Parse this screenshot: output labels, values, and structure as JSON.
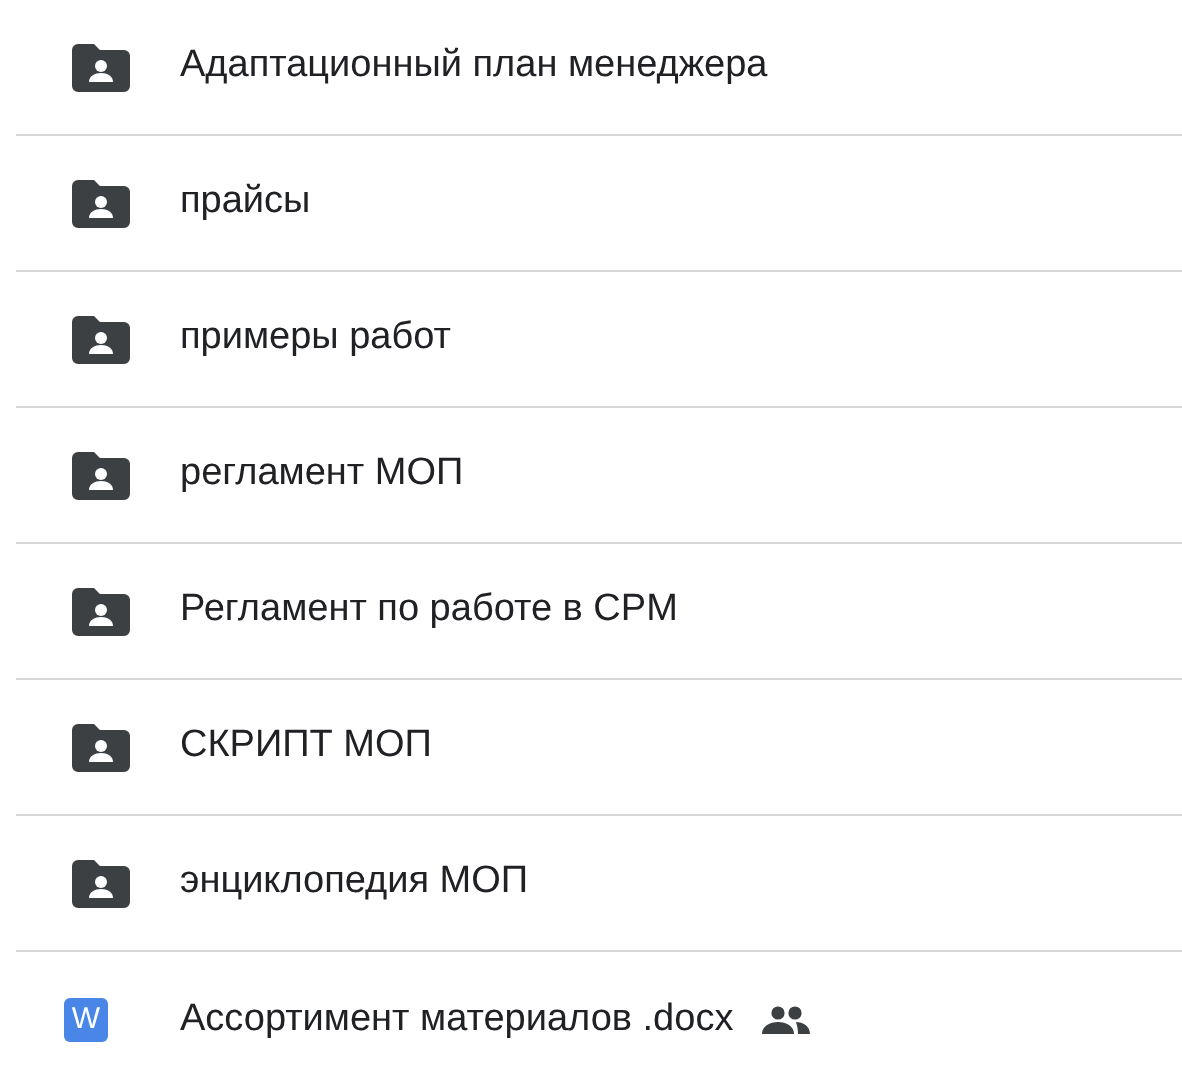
{
  "items": [
    {
      "kind": "folder",
      "name": "Адаптационный план менеджера",
      "shared": false
    },
    {
      "kind": "folder",
      "name": "прайсы",
      "shared": false
    },
    {
      "kind": "folder",
      "name": "примеры работ",
      "shared": false
    },
    {
      "kind": "folder",
      "name": "регламент МОП",
      "shared": false
    },
    {
      "kind": "folder",
      "name": "Регламент по работе в CPM",
      "shared": false
    },
    {
      "kind": "folder",
      "name": "СКРИПТ МОП",
      "shared": false
    },
    {
      "kind": "folder",
      "name": "энциклопедия МОП",
      "shared": false
    },
    {
      "kind": "document",
      "name": "Ассортимент материалов .docx",
      "icon_letter": "W",
      "shared": true
    }
  ]
}
